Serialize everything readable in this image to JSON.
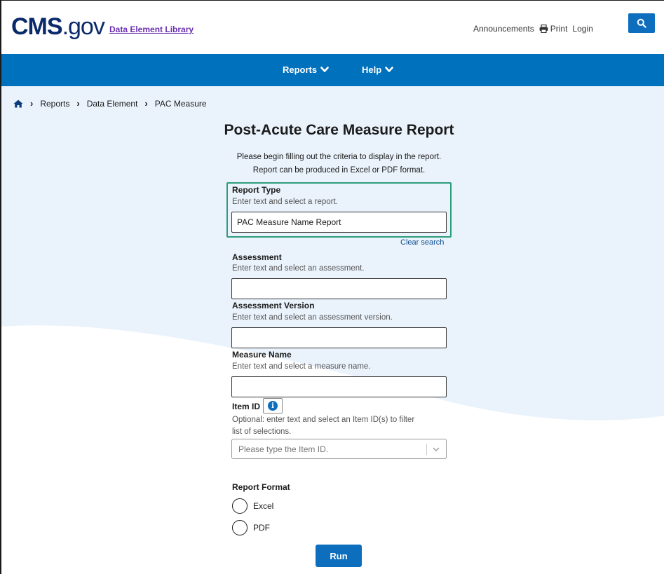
{
  "header": {
    "logo_bold": "CMS",
    "logo_suffix": ".gov",
    "site_link": "Data Element Library",
    "links": [
      "Announcements",
      "Print",
      "Login"
    ],
    "search_icon": "search-icon",
    "print_icon": "printer-icon"
  },
  "nav": {
    "items": [
      {
        "label": "Reports",
        "icon": "chevron-down-icon"
      },
      {
        "label": "Help",
        "icon": "chevron-down-icon"
      }
    ]
  },
  "breadcrumb": {
    "home_icon": "home-icon",
    "items": [
      "Reports",
      "Data Element",
      "PAC Measure"
    ]
  },
  "page": {
    "title": "Post-Acute Care Measure Report",
    "intro_line1": "Please begin filling out the criteria to display in the report.",
    "intro_line2": "Report can be produced in Excel or PDF format."
  },
  "form": {
    "report_type": {
      "label": "Report Type",
      "hint": "Enter text and select a report.",
      "value": "PAC Measure Name Report",
      "clear": "Clear search"
    },
    "assessment": {
      "label": "Assessment",
      "hint": "Enter text and select an assessment.",
      "value": ""
    },
    "assessment_version": {
      "label": "Assessment Version",
      "hint": "Enter text and select an assessment version.",
      "value": ""
    },
    "measure_name": {
      "label": "Measure Name",
      "hint": "Enter text and select a measure name.",
      "value": ""
    },
    "item_id": {
      "label": "Item ID",
      "info_glyph": "i",
      "hint_line1": "Optional: enter text and select an Item ID(s) to filter",
      "hint_line2": "list of selections.",
      "placeholder": "Please type the Item ID."
    },
    "report_format": {
      "label": "Report Format",
      "options": [
        "Excel",
        "PDF"
      ]
    },
    "run_label": "Run"
  },
  "colors": {
    "nav_blue": "#0071bc",
    "button_blue": "#0d6ebd",
    "highlight_green": "#2e9c7a",
    "page_bg": "#eaf3fc"
  }
}
